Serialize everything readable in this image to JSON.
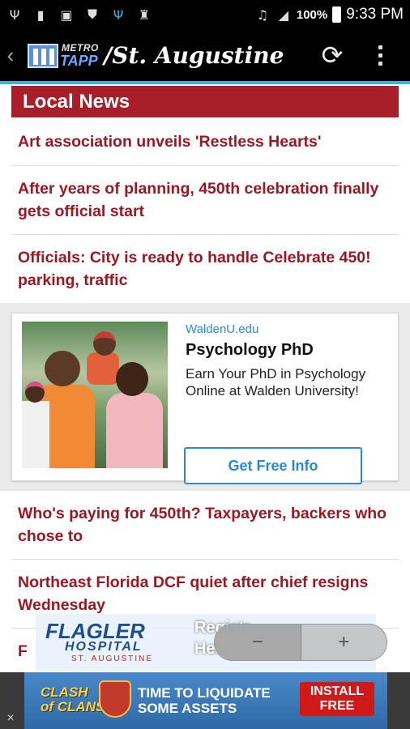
{
  "status_bar": {
    "battery_percent": "100%",
    "time": "9:33 PM",
    "icons": [
      "usb-icon",
      "sd-card-icon",
      "image-icon",
      "shield-wifi-icon",
      "usb-debug-icon",
      "clean-icon",
      "mute-icon",
      "signal-icon",
      "battery-icon"
    ]
  },
  "app_bar": {
    "logo_metro": "METRO",
    "logo_tapp": "TAPP",
    "title": "/St. Augustine"
  },
  "section": {
    "title": "Local News"
  },
  "news": [
    {
      "title": "Art association unveils 'Restless Hearts'"
    },
    {
      "title": "After years of planning, 450th celebration finally gets official start"
    },
    {
      "title": "Officials: City is ready to handle Celebrate 450! parking, traffic"
    },
    {
      "title": "Who's paying for 450th? Taxpayers, backers who chose to"
    },
    {
      "title": "Northeast Florida DCF quiet after chief resigns Wednesday"
    },
    {
      "title": "F"
    }
  ],
  "inline_ad": {
    "domain": "WaldenU.edu",
    "headline": "Psychology PhD",
    "body": "Earn Your PhD in Psychology Online at Walden University!",
    "cta": "Get Free Info"
  },
  "overlay_ad": {
    "name": "FLAGLER",
    "subtitle": "HOSPITAL",
    "location": "ST. AUGUSTINE",
    "link1": "Registr",
    "link2": "Hea"
  },
  "bottom_ad": {
    "game_line1": "CLASH",
    "game_line2": "of CLANS",
    "message_line1": "TIME TO LIQUIDATE",
    "message_line2": "SOME ASSETS",
    "install_line1": "INSTALL",
    "install_line2": "FREE",
    "close": "×"
  },
  "zoom": {
    "out": "−",
    "in": "+"
  }
}
